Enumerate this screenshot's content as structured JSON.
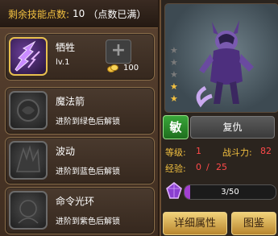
{
  "skill_points": {
    "label": "剩余技能点数:",
    "value": "10",
    "note": "（点数已满）"
  },
  "skills": [
    {
      "name": "牺牲",
      "level": "lv.1",
      "cost": "100",
      "plus": "+"
    },
    {
      "name": "魔法箭",
      "desc": "进阶到绿色后解锁"
    },
    {
      "name": "波动",
      "desc": "进阶到蓝色后解锁"
    },
    {
      "name": "命令光环",
      "desc": "进阶到紫色后解锁"
    }
  ],
  "hero": {
    "stars_total": 5,
    "stars_lit": 2,
    "nature_badge": "敏",
    "nature_name": "复仇",
    "level_label": "等级:",
    "level_value": "1",
    "power_label": "战斗力:",
    "power_value": "82",
    "exp_label": "经验:",
    "exp_value": "0",
    "exp_sep": "/",
    "exp_max": "25",
    "soul_progress": "3/50",
    "soul_fraction": 0.06
  },
  "buttons": {
    "detail": "详细属性",
    "atlas": "图鉴"
  },
  "colors": {
    "gold": "#f2c040",
    "red_value": "#ff4a4a",
    "purple_fill": "#a23fd0",
    "green_badge": "#3aa63a"
  }
}
